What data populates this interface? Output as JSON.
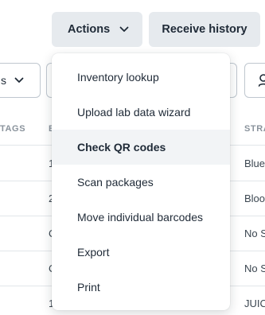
{
  "toolbar": {
    "actions_label": "Actions",
    "receive_history_label": "Receive history"
  },
  "filters": {
    "left_select_value": "s"
  },
  "table": {
    "headers": [
      "TAGS",
      "B",
      "STRA"
    ],
    "rows": [
      {
        "b": "1",
        "stra": "Blue"
      },
      {
        "b": "2",
        "stra": "Bloo"
      },
      {
        "b": "C",
        "stra": "No S"
      },
      {
        "b": "C",
        "stra": "No S"
      },
      {
        "b": "1",
        "stra": "JUIC"
      }
    ]
  },
  "menu": {
    "items": [
      {
        "label": "Inventory lookup"
      },
      {
        "label": "Upload lab data wizard"
      },
      {
        "label": "Check QR codes"
      },
      {
        "label": "Scan packages"
      },
      {
        "label": "Move individual barcodes"
      },
      {
        "label": "Export"
      },
      {
        "label": "Print"
      }
    ],
    "active_index": 2
  }
}
